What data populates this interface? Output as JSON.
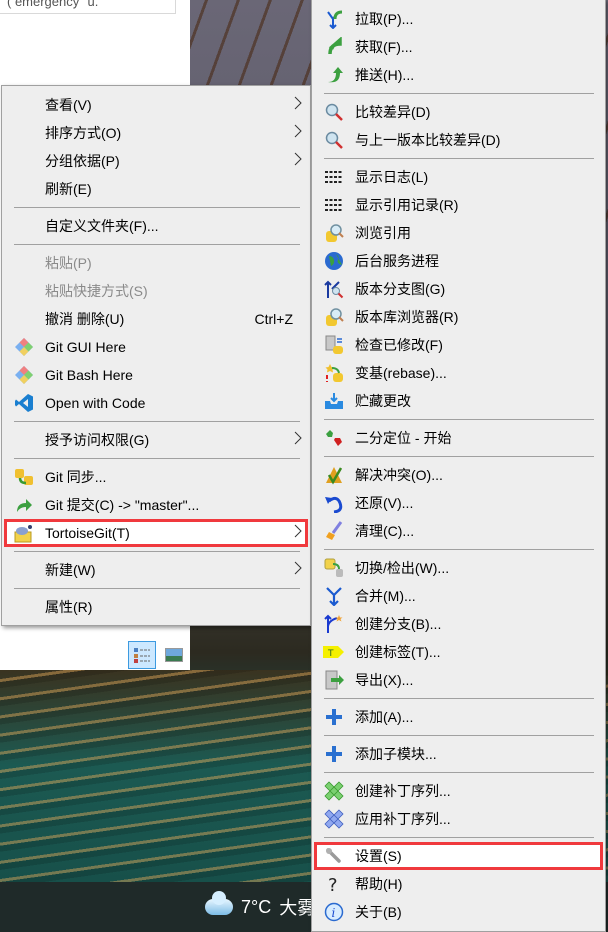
{
  "explorer": {
    "search_text": "( emergency\" u."
  },
  "taskbar": {
    "weather_temp": "7°C",
    "weather_desc": "大雾",
    "weather_icon": "cloud-icon"
  },
  "left_menu": [
    {
      "label": "查看(V)",
      "submenu": true
    },
    {
      "label": "排序方式(O)",
      "submenu": true
    },
    {
      "label": "分组依据(P)",
      "submenu": true
    },
    {
      "label": "刷新(E)"
    },
    {
      "sep": true
    },
    {
      "label": "自定义文件夹(F)..."
    },
    {
      "sep": true
    },
    {
      "label": "粘贴(P)",
      "disabled": true
    },
    {
      "label": "粘贴快捷方式(S)",
      "disabled": true
    },
    {
      "label": "撤消 删除(U)",
      "shortcut": "Ctrl+Z"
    },
    {
      "label": "Git GUI Here",
      "icon": "git-gui"
    },
    {
      "label": "Git Bash Here",
      "icon": "git-gui"
    },
    {
      "label": "Open with Code",
      "icon": "vscode"
    },
    {
      "sep": true
    },
    {
      "label": "授予访问权限(G)",
      "submenu": true
    },
    {
      "sep": true
    },
    {
      "label": "Git 同步...",
      "icon": "sync"
    },
    {
      "label": "Git 提交(C) -> \"master\"...",
      "icon": "commit"
    },
    {
      "label": "TortoiseGit(T)",
      "icon": "tortoise",
      "submenu": true,
      "highlighted": true
    },
    {
      "sep": true
    },
    {
      "label": "新建(W)",
      "submenu": true
    },
    {
      "sep": true
    },
    {
      "label": "属性(R)"
    }
  ],
  "right_menu": [
    {
      "label": "拉取(P)...",
      "icon": "pull"
    },
    {
      "label": "获取(F)...",
      "icon": "fetch"
    },
    {
      "label": "推送(H)...",
      "icon": "push"
    },
    {
      "sep": true
    },
    {
      "label": "比较差异(D)",
      "icon": "diff"
    },
    {
      "label": "与上一版本比较差异(D)",
      "icon": "diff"
    },
    {
      "sep": true
    },
    {
      "label": "显示日志(L)",
      "icon": "log"
    },
    {
      "label": "显示引用记录(R)",
      "icon": "log"
    },
    {
      "label": "浏览引用",
      "icon": "repo-browse"
    },
    {
      "label": "后台服务进程",
      "icon": "globe"
    },
    {
      "label": "版本分支图(G)",
      "icon": "revgraph"
    },
    {
      "label": "版本库浏览器(R)",
      "icon": "repo-browse"
    },
    {
      "label": "检查已修改(F)",
      "icon": "check-mods"
    },
    {
      "label": "变基(rebase)...",
      "icon": "rebase"
    },
    {
      "label": "贮藏更改",
      "icon": "stash"
    },
    {
      "sep": true
    },
    {
      "label": "二分定位 - 开始",
      "icon": "bisect"
    },
    {
      "sep": true
    },
    {
      "label": "解决冲突(O)...",
      "icon": "resolve"
    },
    {
      "label": "还原(V)...",
      "icon": "revert"
    },
    {
      "label": "清理(C)...",
      "icon": "cleanup"
    },
    {
      "sep": true
    },
    {
      "label": "切换/检出(W)...",
      "icon": "switch"
    },
    {
      "label": "合并(M)...",
      "icon": "merge"
    },
    {
      "label": "创建分支(B)...",
      "icon": "branch"
    },
    {
      "label": "创建标签(T)...",
      "icon": "tag"
    },
    {
      "label": "导出(X)...",
      "icon": "export"
    },
    {
      "sep": true
    },
    {
      "label": "添加(A)...",
      "icon": "add"
    },
    {
      "sep": true
    },
    {
      "label": "添加子模块...",
      "icon": "add"
    },
    {
      "sep": true
    },
    {
      "label": "创建补丁序列...",
      "icon": "patch-green"
    },
    {
      "label": "应用补丁序列...",
      "icon": "patch-blue"
    },
    {
      "sep": true
    },
    {
      "label": "设置(S)",
      "icon": "wrench",
      "highlighted": true
    },
    {
      "label": "帮助(H)",
      "icon": "help"
    },
    {
      "label": "关于(B)",
      "icon": "info"
    }
  ],
  "colors": {
    "menu_bg": "#eeeeee",
    "highlight_border": "#f0393d",
    "taskbar": "#1f2a29"
  }
}
